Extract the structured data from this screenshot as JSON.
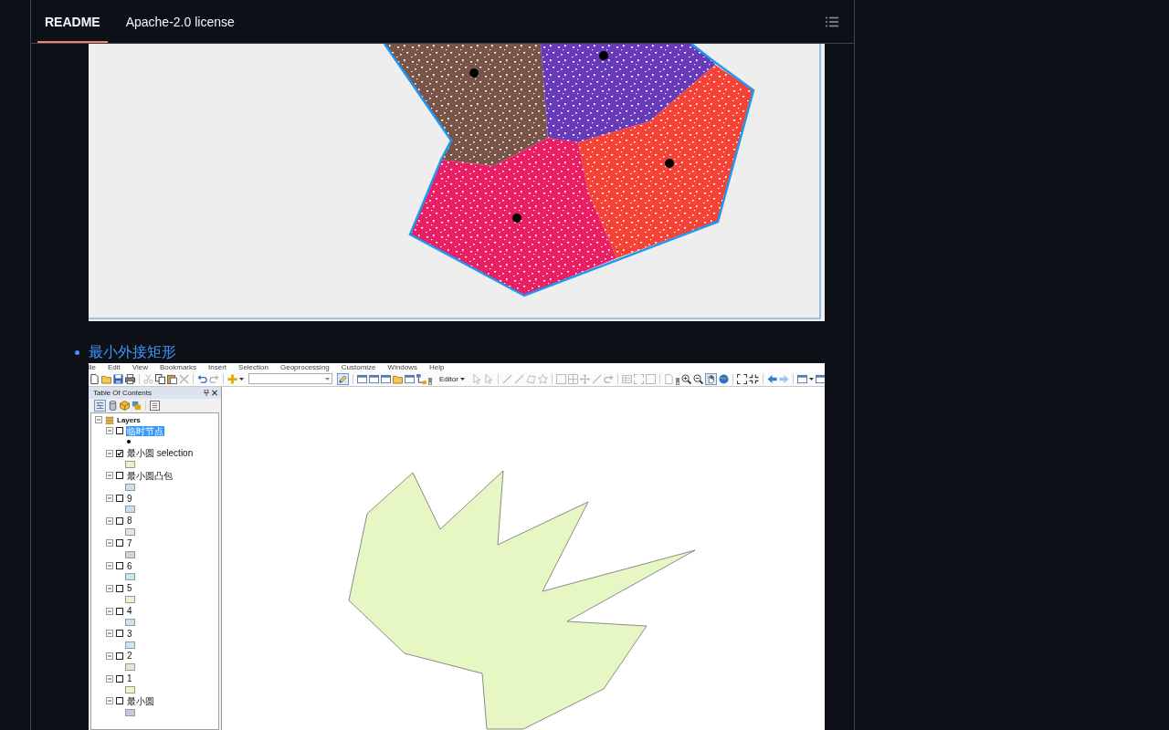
{
  "tabs": [
    {
      "label": "README",
      "selected": true
    },
    {
      "label": "Apache-2.0 license",
      "selected": false
    }
  ],
  "readme": {
    "list_item_link": "最小外接矩形",
    "arcmap_screenshot": {
      "menu_bar": [
        "ile",
        "Edit",
        "View",
        "Bookmarks",
        "Insert",
        "Selection",
        "Geoprocessing",
        "Customize",
        "Windows",
        "Help"
      ],
      "toolbar": {
        "editor_menu": "Editor"
      },
      "table_of_contents": {
        "title": "Table Of Contents",
        "root": {
          "label": "Layers",
          "expanded": true
        },
        "layers": [
          {
            "name": "临时节点",
            "kind": "point",
            "checked": false,
            "selected": true,
            "expanded": true
          },
          {
            "name": "最小圆 selection",
            "kind": "polygon",
            "color": "#e6f5c6",
            "checked": true,
            "selected": false,
            "expanded": true
          },
          {
            "name": "最小圆凸包",
            "kind": "polygon",
            "color": "#c6e2ec",
            "checked": false,
            "selected": false,
            "expanded": true
          },
          {
            "name": "9",
            "kind": "polygon",
            "color": "#c2dff0",
            "checked": false,
            "selected": false,
            "expanded": true
          },
          {
            "name": "8",
            "kind": "polygon",
            "color": "#e4e4e4",
            "checked": false,
            "selected": false,
            "expanded": true
          },
          {
            "name": "7",
            "kind": "polygon",
            "color": "#c9d2ea",
            "checked": false,
            "selected": false,
            "expanded": true
          },
          {
            "name": "6",
            "kind": "polygon",
            "color": "#bde9f0",
            "checked": false,
            "selected": false,
            "expanded": true
          },
          {
            "name": "5",
            "kind": "polygon",
            "color": "#e8f5c8",
            "checked": false,
            "selected": false,
            "expanded": true
          },
          {
            "name": "4",
            "kind": "polygon",
            "color": "#c7e3ee",
            "checked": false,
            "selected": false,
            "expanded": true
          },
          {
            "name": "3",
            "kind": "polygon",
            "color": "#c8e7ee",
            "checked": false,
            "selected": false,
            "expanded": true
          },
          {
            "name": "2",
            "kind": "polygon",
            "color": "#efe3cf",
            "checked": false,
            "selected": false,
            "expanded": true
          },
          {
            "name": "1",
            "kind": "polygon",
            "color": "#eef7bf",
            "checked": false,
            "selected": false,
            "expanded": true
          },
          {
            "name": "最小圆",
            "kind": "polygon",
            "color": "#c4c9de",
            "checked": false,
            "selected": false,
            "expanded": true
          }
        ]
      }
    }
  }
}
